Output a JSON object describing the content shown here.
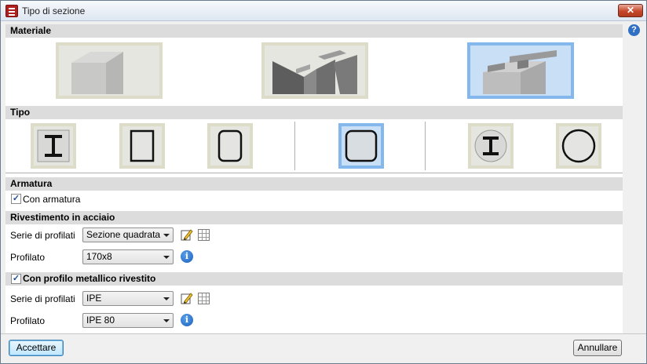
{
  "window": {
    "title": "Tipo di sezione",
    "close_glyph": "✕",
    "help_glyph": "?"
  },
  "sections": {
    "materiale": "Materiale",
    "tipo": "Tipo",
    "armatura": "Armatura",
    "rivestimento": "Rivestimento in acciaio",
    "profilo_rivestito": "Con profilo metallico rivestito"
  },
  "materiale_options": [
    {
      "name": "concrete",
      "selected": false
    },
    {
      "name": "steel",
      "selected": false
    },
    {
      "name": "composite",
      "selected": true
    }
  ],
  "tipo_options": [
    {
      "name": "encased-i-section",
      "selected": false
    },
    {
      "name": "rectangular-tube",
      "selected": false
    },
    {
      "name": "rounded-rectangular-tube",
      "selected": false
    },
    {
      "name": "square-tube",
      "selected": true
    },
    {
      "name": "circular-i-section",
      "selected": false
    },
    {
      "name": "circular-tube",
      "selected": false
    }
  ],
  "armatura": {
    "checkbox_label": "Con armatura",
    "checked": true
  },
  "rivestimento": {
    "serie_label": "Serie di profilati",
    "serie_value": "Sezione quadrata",
    "profilato_label": "Profilato",
    "profilato_value": "170x8"
  },
  "profilo_rivestito": {
    "checked": true,
    "serie_label": "Serie di profilati",
    "serie_value": "IPE",
    "profilato_label": "Profilato",
    "profilato_value": "IPE 80"
  },
  "buttons": {
    "accept": "Accettare",
    "cancel": "Annullare"
  },
  "icons": {
    "info_glyph": "i",
    "check_glyph": "✓"
  },
  "colors": {
    "selection_border": "#84b8ec",
    "tile_border": "#dcdcc8",
    "section_header": "#dcdcdc"
  }
}
